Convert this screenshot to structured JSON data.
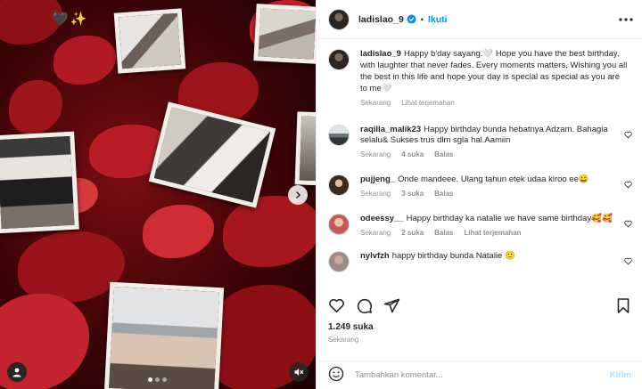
{
  "media": {
    "emojis": [
      "🖤",
      "✨"
    ],
    "slide_count": 3,
    "active_slide": 1
  },
  "header": {
    "username": "ladislao_9",
    "separator": "•",
    "follow_label": "Ikuti"
  },
  "caption": {
    "username": "ladislao_9",
    "text": "Happy b'day sayang.🤍 Hope you have the best birthday, with laughter that never fades. Every moments matters, Wishing you all the best in this life and hope your day is special as special as you are to me🤍",
    "time": "Sekarang",
    "translate": "Lihat terjemahan"
  },
  "comments": [
    {
      "username": "raqilla_malik23",
      "text": "Happy birthday bunda hebatnya Adzam. Bahagia selalu& Sukses trus dlm sgla hal.Aamiin",
      "time": "Sekarang",
      "likes": "4 suka",
      "reply": "Balas"
    },
    {
      "username": "pujjeng_",
      "text": "Onde mandeee. Ulang tahun etek udaa kiroo ee😀",
      "time": "Sekarang",
      "likes": "3 suka",
      "reply": "Balas"
    },
    {
      "username": "odeessy__",
      "text": "Happy birthday ka natalie we have same birthday🥰🥰",
      "time": "Sekarang",
      "likes": "2 suka",
      "reply": "Balas",
      "translate": "Lihat terjemahan"
    },
    {
      "username": "nylvfzh",
      "text": "happy birthday bunda Natalie 🙂"
    }
  ],
  "footer": {
    "likes": "1.249 suka",
    "time": "Sekarang"
  },
  "add_comment": {
    "placeholder": "Tambahkan komentar...",
    "post_label": "Kirim"
  },
  "colors": {
    "accent": "#0095f6",
    "muted": "#8e8e8e",
    "text": "#262626",
    "post_disabled": "#b2dffc"
  }
}
